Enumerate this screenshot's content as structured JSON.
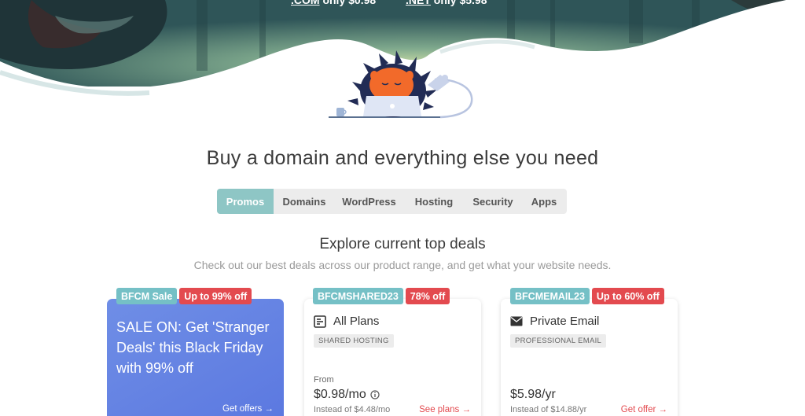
{
  "hero": {
    "promo_com_tld": ".COM",
    "promo_com_price": "only $0.98",
    "promo_net_tld": ".NET",
    "promo_net_price": "only $5.98"
  },
  "heading": "Buy a domain and everything else you need",
  "tabs": [
    {
      "label": "Promos",
      "active": true
    },
    {
      "label": "Domains",
      "active": false
    },
    {
      "label": "WordPress",
      "active": false
    },
    {
      "label": "Hosting",
      "active": false
    },
    {
      "label": "Security",
      "active": false
    },
    {
      "label": "Apps",
      "active": false
    }
  ],
  "deals": {
    "title": "Explore current top deals",
    "subtitle": "Check out our best deals across our product range, and get what your website needs.",
    "cards": [
      {
        "badge_code": "BFCM Sale",
        "badge_discount": "Up to 99% off",
        "text": "SALE ON: Get 'Stranger Deals' this Black Friday with 99% off",
        "cta": "Get offers →"
      },
      {
        "badge_code": "BFCMSHARED23",
        "badge_discount": "78% off",
        "title": "All Plans",
        "tag": "SHARED HOSTING",
        "from": "From",
        "price": "$0.98/mo",
        "instead": "Instead of $4.48/mo",
        "cta": "See plans →",
        "icon": "server-icon"
      },
      {
        "badge_code": "BFCMEMAIL23",
        "badge_discount": "Up to 60% off",
        "title": "Private Email",
        "tag": "PROFESSIONAL EMAIL",
        "price": "$5.98/yr",
        "instead": "Instead of $14.88/yr",
        "cta": "Get offer →",
        "icon": "envelope-icon"
      }
    ]
  },
  "colors": {
    "tab_active": "#8ec6c5",
    "badge_teal": "#75c0c6",
    "badge_red": "#e34a4f",
    "promo_card": "#5b78e0"
  }
}
